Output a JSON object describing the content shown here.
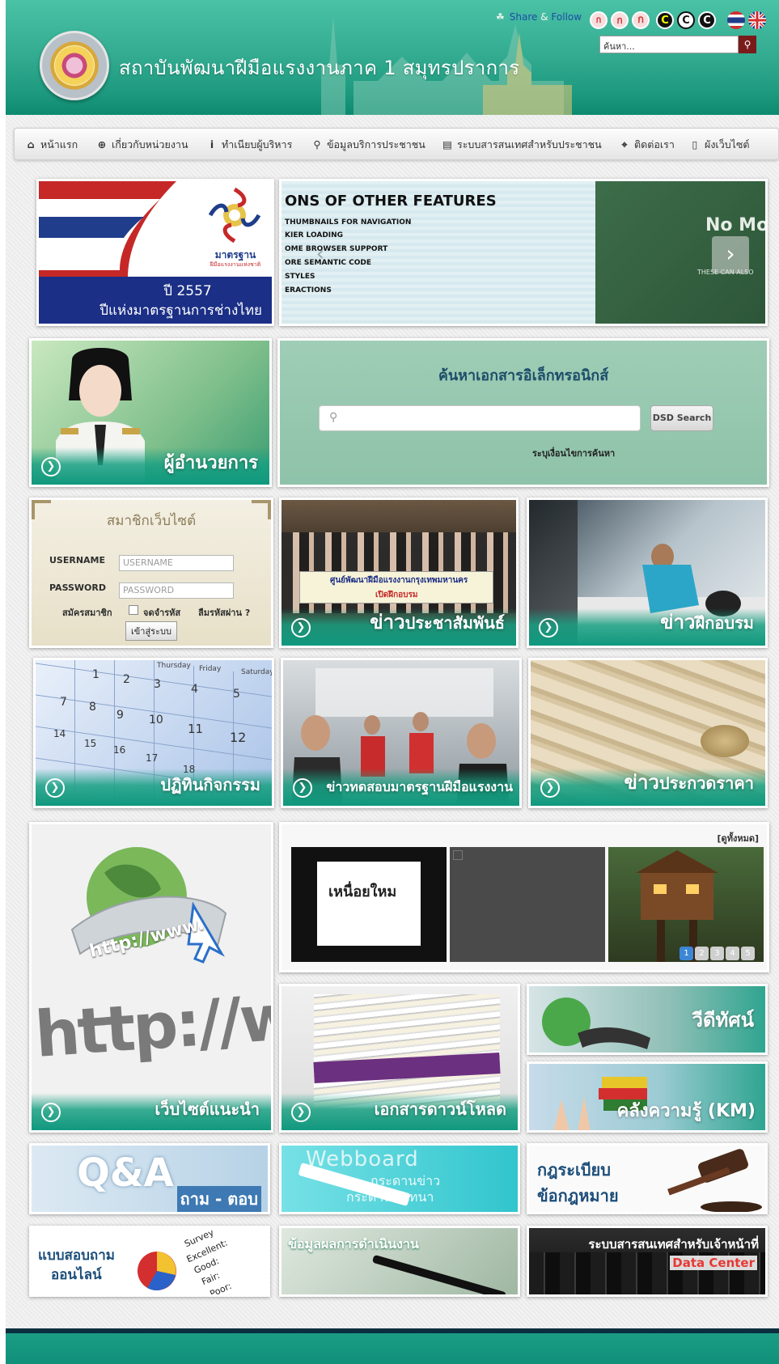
{
  "header": {
    "site_title": "สถาบันพัฒนาฝีมือแรงงานภาค 1 สมุทรปราการ",
    "share_label": "Share",
    "share_amp": "&",
    "follow_label": "Follow",
    "font_buttons": [
      "ก",
      "ก",
      "ก"
    ],
    "contrast_buttons": [
      "C",
      "C",
      "C"
    ],
    "search_placeholder": "ค้นหา...",
    "colors": {
      "brand": "#1e9a80",
      "accent": "#49c2a6"
    }
  },
  "nav": {
    "items": [
      {
        "label": "หน้าแรก",
        "icon": "home-icon"
      },
      {
        "label": "เกี่ยวกับหน่วยงาน",
        "icon": "plus-circle-icon"
      },
      {
        "label": "ทำเนียบผู้บริหาร",
        "icon": "info-icon"
      },
      {
        "label": "ข้อมูลบริการประชาชน",
        "icon": "search-icon"
      },
      {
        "label": "ระบบสารสนเทศสำหรับประชาชน",
        "icon": "book-icon"
      },
      {
        "label": "ติดต่อเรา",
        "icon": "map-pin-icon"
      },
      {
        "label": "ผังเว็บไซต์",
        "icon": "mobile-icon"
      }
    ]
  },
  "banner": {
    "year_line": "ปี 2557",
    "caption": "ปีแห่งมาตรฐานการช่างไทย",
    "logo_text": "มาตรฐาน",
    "logo_sub": "ฝีมือแรงงานแห่งชาติ"
  },
  "slider": {
    "heading": "ONS OF OTHER FEATURES",
    "lines": [
      "THUMBNAILS FOR NAVIGATION",
      "KIER LOADING",
      "OME BROWSER SUPPORT",
      "ORE SEMANTIC CODE",
      "STYLES",
      "ERACTIONS"
    ],
    "chalk_text": "No Mo",
    "chalk_sub": "THESE CAN ALSO"
  },
  "director": {
    "label": "ผู้อำนวยการ"
  },
  "edoc": {
    "title": "ค้นหาเอกสารอิเล็กทรอนิกส์",
    "button": "DSD Search",
    "hint": "ระบุเงื่อนไขการค้นหา"
  },
  "login": {
    "title": "สมาชิกเว็บไซต์",
    "username_label": "USERNAME",
    "password_label": "PASSWORD",
    "username_placeholder": "USERNAME",
    "password_placeholder": "PASSWORD",
    "register": "สมัครสมาชิก",
    "remember": "จดจำรหัส",
    "forgot": "ลืมรหัสผ่าน ?",
    "submit": "เข้าสู่ระบบ"
  },
  "tiles": {
    "pr_news_big": "ข่าว",
    "pr_news": "ประชาสัมพันธ์",
    "pr_banner_line1": "ศูนย์พัฒนาฝีมือแรงงานกรุงเทพมหานคร",
    "pr_banner_line2": "เปิดฝึกอบรม",
    "training_big": "ข่าว",
    "training": "ฝึกอบรม",
    "calendar": "ปฏิทินกิจกรรม",
    "calendar_days": [
      "Thursday",
      "Friday",
      "Saturday"
    ],
    "calendar_numbers": [
      "1",
      "2",
      "3",
      "4",
      "5",
      "7",
      "8",
      "9",
      "10",
      "11",
      "12",
      "14",
      "15",
      "16",
      "17",
      "18"
    ],
    "standard_test": "ข่าวทดสอบมาตรฐานฝีมือแรงงาน",
    "price_big": "ข่าว",
    "price": "ประกวดราคา",
    "websites": "เว็บไซต์แนะนำ",
    "http_text": "http://www.",
    "http_big": "http://www",
    "downloads": "เอกสารดาวน์โหลด",
    "video": "วีดีทัศน์",
    "km": "คลังความรู้ (KM)"
  },
  "videobox": {
    "all_label": "[ดูทั้งหมด]",
    "thumb_text": "เหนื่อยใหม",
    "pages": [
      "1",
      "2",
      "3",
      "4",
      "5"
    ]
  },
  "links": {
    "qa_big": "Q&A",
    "qa_thai": "ถาม - ตอบ",
    "webboard_title": "Webboard",
    "webboard_sub1": "กระดานข่าว",
    "webboard_sub2": "กระดานสนทนา",
    "law_line1": "กฎระเบียบ",
    "law_line2": "ข้อกฎหมาย",
    "survey_line1": "แบบสอบถาม",
    "survey_line2": "ออนไลน์",
    "survey_words": [
      "Survey",
      "Excellent:",
      "Good:",
      "Fair:",
      "Poor:"
    ],
    "ops_title": "ข้อมูลผลการดำเนินงาน",
    "dc_title": "ระบบสารสนเทศสำหรับเจ้าหน้าที่",
    "dc_sub": "Data Center"
  }
}
